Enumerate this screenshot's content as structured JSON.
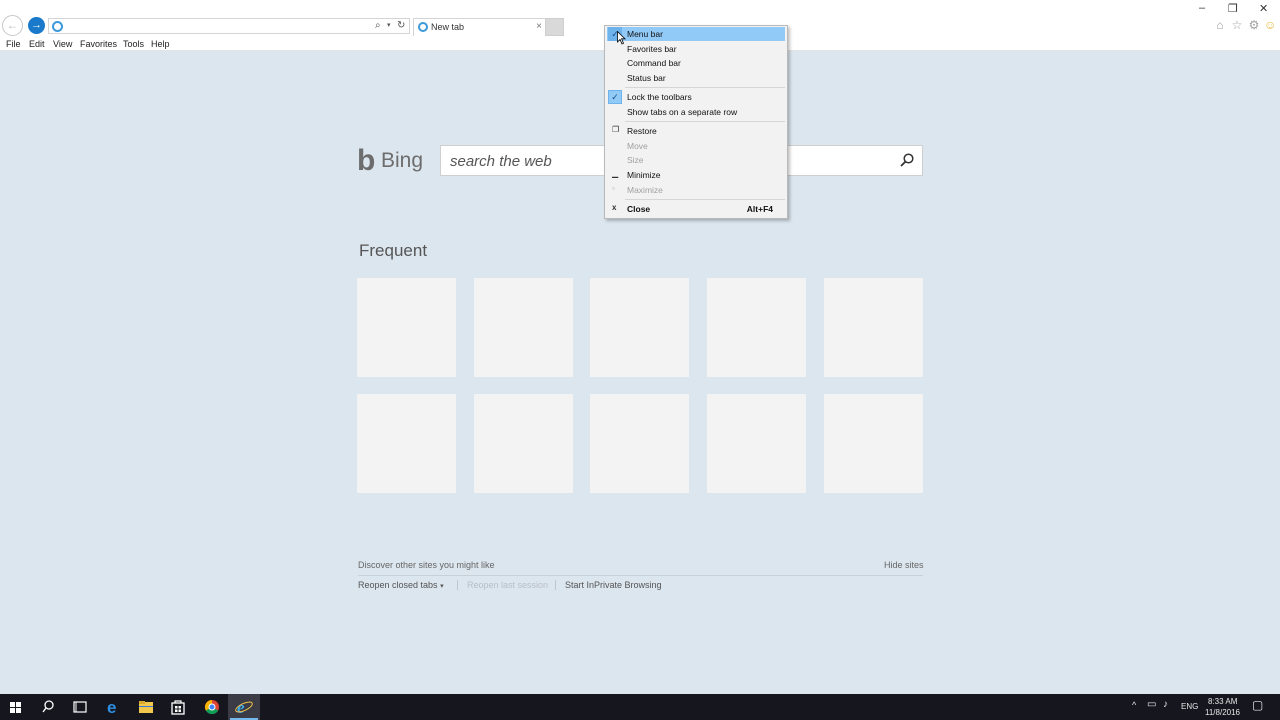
{
  "browser": {
    "address_value": "",
    "tab_title": "New tab",
    "tab_close": "×"
  },
  "window_controls": {
    "minimize": "–",
    "restore": "❐",
    "close": "✕"
  },
  "menubar": {
    "items": [
      "File",
      "Edit",
      "View",
      "Favorites",
      "Tools",
      "Help"
    ]
  },
  "page": {
    "logo_text": "Bing",
    "search_placeholder": "search the web",
    "frequent_title": "Frequent",
    "discover_text": "Discover other sites you might like",
    "hide_sites": "Hide sites",
    "reopen_closed_tabs": "Reopen closed tabs",
    "reopen_last_session": "Reopen last session",
    "start_inprivate": "Start InPrivate Browsing"
  },
  "context_menu": {
    "menu_bar": "Menu bar",
    "favorites_bar": "Favorites bar",
    "command_bar": "Command bar",
    "status_bar": "Status bar",
    "lock_toolbars": "Lock the toolbars",
    "show_tabs": "Show tabs on a separate row",
    "restore": "Restore",
    "move": "Move",
    "size": "Size",
    "minimize": "Minimize",
    "maximize": "Maximize",
    "close": "Close",
    "close_accel": "Alt+F4"
  },
  "taskbar": {
    "time": "8:33 AM",
    "date": "11/8/2016",
    "language": "ENG"
  },
  "colors": {
    "page_bg": "#dce6ef",
    "menu_highlight": "#91c9f7",
    "ie_blue": "#1979ca",
    "taskbar": "#15161e"
  }
}
